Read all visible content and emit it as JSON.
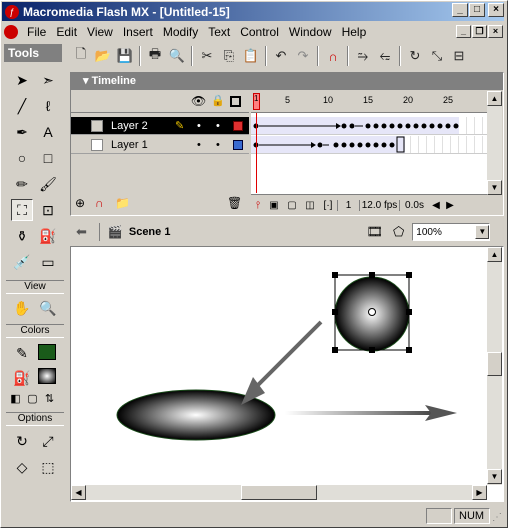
{
  "window": {
    "title": "Macromedia Flash MX - [Untitled-15]"
  },
  "menu": [
    "File",
    "Edit",
    "View",
    "Insert",
    "Modify",
    "Text",
    "Control",
    "Window",
    "Help"
  ],
  "tools": {
    "header": "Tools",
    "view_label": "View",
    "colors_label": "Colors",
    "options_label": "Options"
  },
  "colors": {
    "stroke": "#1a5b1a",
    "fill_gradient": "radial black-white",
    "current_layer": "#e03030",
    "layer1": "#3a6ad0"
  },
  "timeline": {
    "header": "Timeline",
    "layers": [
      {
        "name": "Layer 2",
        "selected": true
      },
      {
        "name": "Layer 1",
        "selected": false
      }
    ],
    "ruler": [
      "1",
      "5",
      "10",
      "15",
      "20",
      "25"
    ],
    "current_frame": "1",
    "fps": "12.0 fps",
    "time": "0.0s"
  },
  "scene": {
    "name": "Scene 1",
    "zoom": "100%"
  },
  "status": {
    "num": "NUM"
  }
}
